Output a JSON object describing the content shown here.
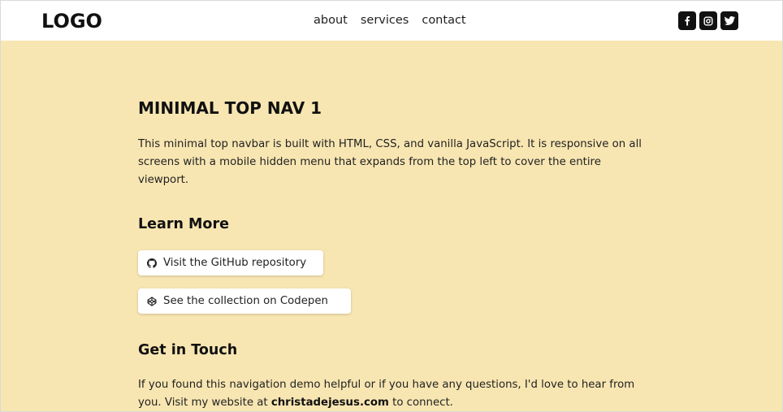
{
  "nav": {
    "logo": "LOGO",
    "links": [
      "about",
      "services",
      "contact"
    ],
    "social_icons": [
      "facebook-icon",
      "instagram-icon",
      "twitter-icon"
    ]
  },
  "main": {
    "title": "MINIMAL TOP NAV 1",
    "intro": "This minimal top navbar is built with HTML, CSS, and vanilla JavaScript. It is responsive on all screens with a mobile hidden menu that expands from the top left to cover the entire viewport.",
    "learn_more": {
      "heading": "Learn More",
      "github_label": "Visit the GitHub repository",
      "codepen_label": "See the collection on Codepen",
      "github_icon": "github-icon",
      "codepen_icon": "codepen-icon"
    },
    "get_in_touch": {
      "heading": "Get in Touch",
      "text_before": "If you found this navigation demo helpful or if you have any questions, I'd love to hear from you. Visit my website at ",
      "website": "christadejesus.com",
      "text_after": " to connect."
    }
  },
  "colors": {
    "background": "#f8e6b2",
    "nav_background": "#ffffff",
    "social_button": "#111111"
  }
}
